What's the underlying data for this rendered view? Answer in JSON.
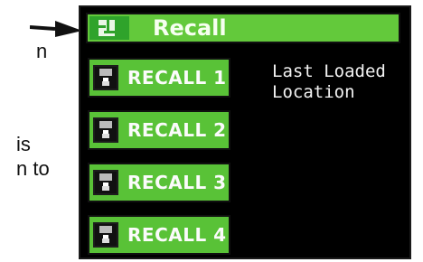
{
  "doc_fragments": {
    "line1": "n",
    "line2": "is",
    "line3": "n to"
  },
  "ui": {
    "title": "Recall",
    "buttons": [
      {
        "label": "RECALL 1"
      },
      {
        "label": "RECALL 2"
      },
      {
        "label": "RECALL 3"
      },
      {
        "label": "RECALL 4"
      }
    ],
    "info_lines": [
      "Last Loaded",
      "Location"
    ]
  },
  "colors": {
    "green": "#5ac237",
    "dark_green": "#2fa32b",
    "screen_bg": "#000000"
  },
  "icons": {
    "title_icon": "layout-grid-icon",
    "button_icon": "disk-icon"
  }
}
